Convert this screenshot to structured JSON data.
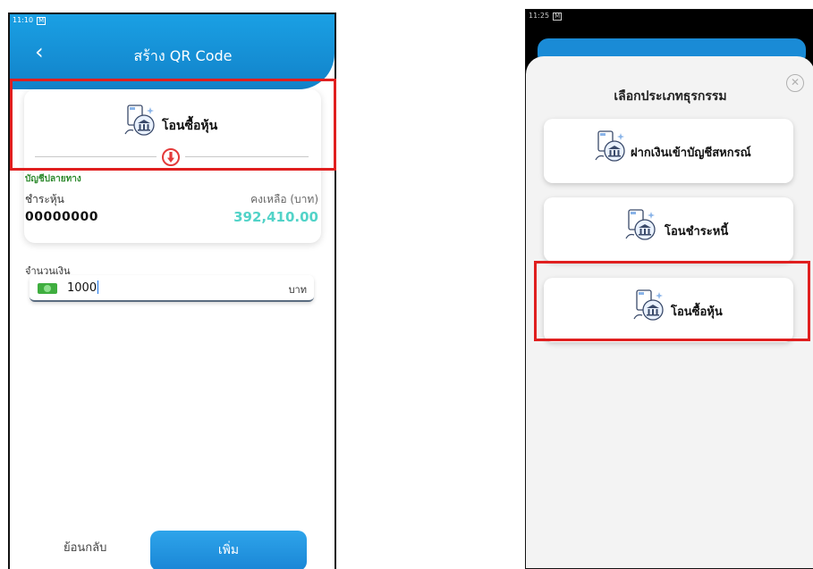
{
  "left": {
    "status_time": "11:10",
    "status_badge": "M",
    "header": {
      "back_icon": "chevron-left",
      "title": "สร้าง QR Code"
    },
    "transaction_type": "โอนซื้อหุ้น",
    "destination_label": "บัญชีปลายทาง",
    "account_type": "ชำระหุ้น",
    "balance_label": "คงเหลือ (บาท)",
    "account_number": "00000000",
    "balance": "392,410.00",
    "amount_label": "จำนวนเงิน",
    "amount_value": "1000",
    "amount_unit": "บาท",
    "back_button": "ย้อนกลับ",
    "add_button": "เพิ่ม"
  },
  "right": {
    "status_time": "11:25",
    "status_badge": "M",
    "sheet_title": "เลือกประเภทธุรกรรม",
    "close_icon": "close-circle",
    "options": [
      {
        "label": "ฝากเงินเข้าบัญชีสหกรณ์"
      },
      {
        "label": "โอนชำระหนี้"
      },
      {
        "label": "โอนซื้อหุ้น"
      }
    ]
  },
  "colors": {
    "header_blue": "#1a8bd6",
    "highlight_red": "#e01f1f",
    "balance_teal": "#52d3c8",
    "destination_green": "#2e8a2e"
  }
}
